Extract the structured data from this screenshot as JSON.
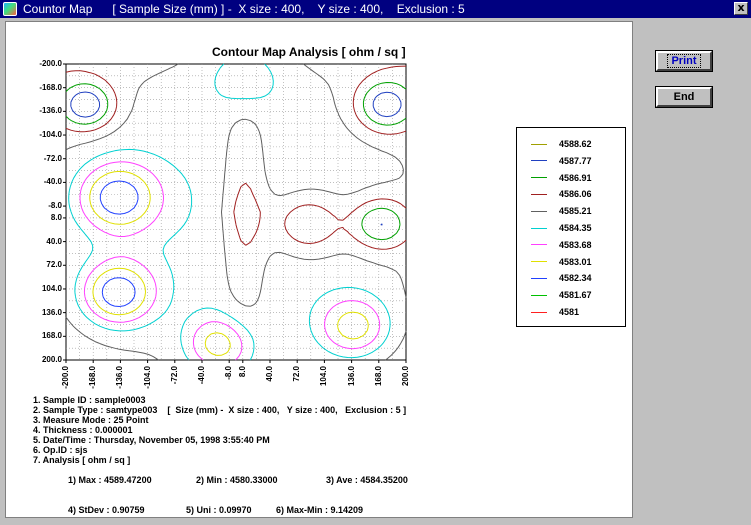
{
  "window": {
    "title": "Countor Map      [ Sample Size (mm) ] -  X size : 400,    Y size : 400,    Exclusion : 5",
    "close_label": "x"
  },
  "buttons": {
    "print_label": "Print",
    "end_label": "End"
  },
  "chart_data": {
    "type": "contour",
    "title": "Contour Map Analysis  [ ohm / sq ]",
    "xlabel": "",
    "ylabel": "",
    "xlim": [
      -200.0,
      200.0
    ],
    "ylim": [
      -200.0,
      200.0
    ],
    "y_inverted": true,
    "grid": true,
    "x_ticks": [
      "-200.0",
      "-168.0",
      "-136.0",
      "-104.0",
      "-72.0",
      "-40.0",
      "-8.0",
      "8.0",
      "40.0",
      "72.0",
      "104.0",
      "136.0",
      "168.0",
      "200.0"
    ],
    "y_ticks": [
      "-200.0",
      "-168.0",
      "-136.0",
      "-104.0",
      "-72.0",
      "-40.0",
      "-8.0",
      "8.0",
      "40.0",
      "72.0",
      "104.0",
      "136.0",
      "168.0",
      "200.0"
    ],
    "legend_position": "right",
    "levels": [
      {
        "value": "4588.62",
        "color": "#a0a000"
      },
      {
        "value": "4587.77",
        "color": "#2040c0"
      },
      {
        "value": "4586.91",
        "color": "#00a000"
      },
      {
        "value": "4586.06",
        "color": "#a02020"
      },
      {
        "value": "4585.21",
        "color": "#606060"
      },
      {
        "value": "4584.35",
        "color": "#00d0d0"
      },
      {
        "value": "4583.68",
        "color": "#ff40ff"
      },
      {
        "value": "4583.01",
        "color": "#e0e000"
      },
      {
        "value": "4582.34",
        "color": "#2040ff"
      },
      {
        "value": "4581.67",
        "color": "#00c000"
      },
      {
        "value": "4581",
        "color": "#ff2020"
      }
    ]
  },
  "info": {
    "lines": [
      "1. Sample ID : sample0003",
      "2. Sample Type : samtype003    [  Size (mm) -  X size : 400,   Y size : 400,   Exclusion : 5 ]",
      "3. Measure Mode : 25 Point",
      "4. Thickness : 0.000001",
      "5. Date/Time : Thursday, November 05, 1998 3:55:40 PM",
      "6. Op.ID : sjs",
      "7. Analysis [ ohm / sq ]"
    ],
    "analysis": [
      [
        "1) Max : 4589.47200",
        "2) Min : 4580.33000",
        "3) Ave : 4584.35200"
      ],
      [
        "4) StDev : 0.90759",
        "5) Uni : 0.09970",
        "6) Max-Min : 9.14209"
      ]
    ]
  }
}
